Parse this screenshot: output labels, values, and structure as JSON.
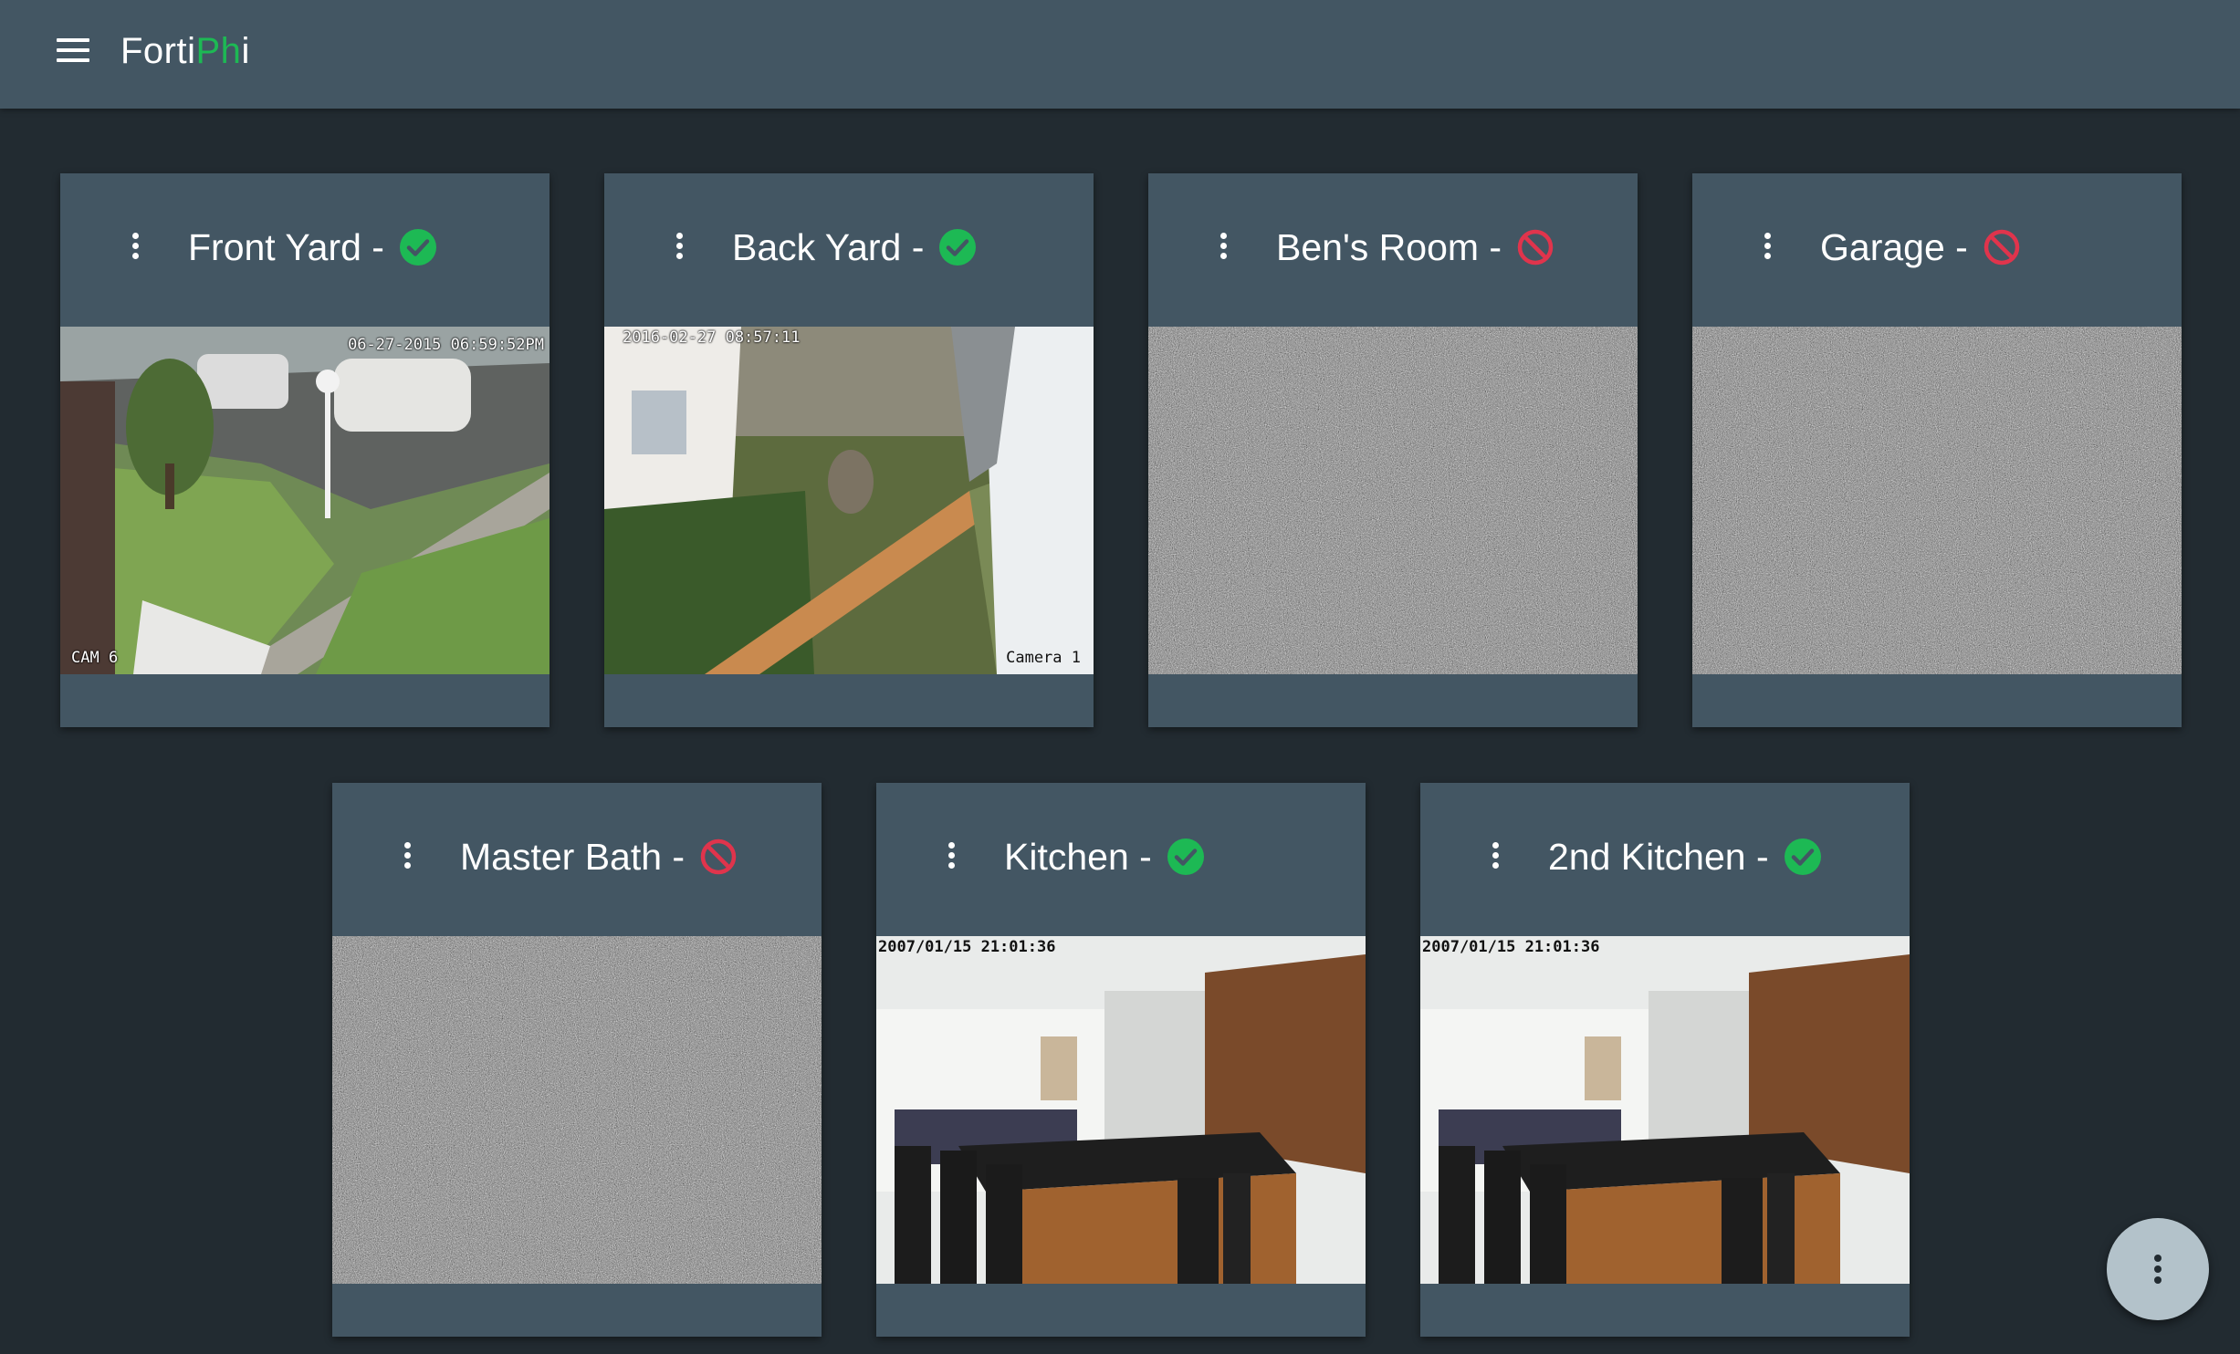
{
  "app": {
    "brand_part1": "Forti",
    "brand_part2": "Ph",
    "brand_part3": "i",
    "brand_accent_color": "#1db954"
  },
  "cameras": [
    {
      "title": "Front Yard -",
      "status": "online",
      "status_icon": "check-circle-icon",
      "stamp_top": "06-27-2015 06:59:52PM",
      "stamp_bottom": "CAM 6"
    },
    {
      "title": "Back Yard -",
      "status": "online",
      "status_icon": "check-circle-icon",
      "stamp_top": "2016-02-27 08:57:11",
      "stamp_bottom": "Camera 1"
    },
    {
      "title": "Ben's Room -",
      "status": "offline",
      "status_icon": "blocked-icon"
    },
    {
      "title": "Garage -",
      "status": "offline",
      "status_icon": "blocked-icon"
    },
    {
      "title": "Master Bath -",
      "status": "offline",
      "status_icon": "blocked-icon"
    },
    {
      "title": "Kitchen -",
      "status": "online",
      "status_icon": "check-circle-icon",
      "stamp_top": "2007/01/15 21:01:36"
    },
    {
      "title": "2nd Kitchen -",
      "status": "online",
      "status_icon": "check-circle-icon",
      "stamp_top": "2007/01/15 21:01:36"
    }
  ],
  "colors": {
    "online": "#1db954",
    "offline": "#e0344c",
    "header_bg": "#435663",
    "page_bg": "#222b31"
  }
}
